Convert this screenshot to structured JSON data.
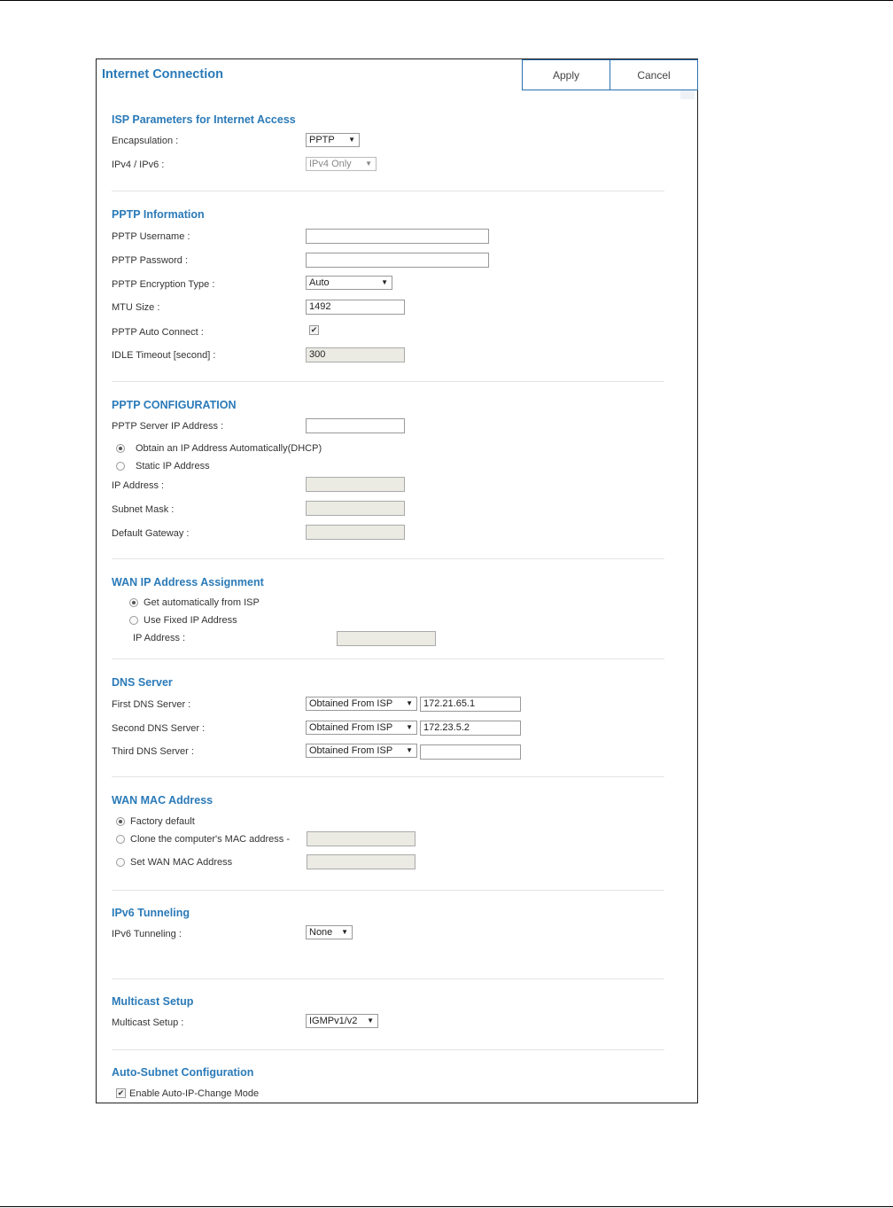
{
  "header": {
    "title": "Internet Connection",
    "apply_label": "Apply",
    "cancel_label": "Cancel"
  },
  "isp": {
    "heading": "ISP Parameters for Internet Access",
    "encapsulation_label": "Encapsulation :",
    "encapsulation_value": "PPTP",
    "ipver_label": "IPv4 / IPv6 :",
    "ipver_value": "IPv4 Only"
  },
  "pptp_info": {
    "heading": "PPTP Information",
    "username_label": "PPTP Username :",
    "username_value": "",
    "password_label": "PPTP Password :",
    "password_value": "",
    "encryption_label": "PPTP Encryption Type :",
    "encryption_value": "Auto",
    "mtu_label": "MTU Size :",
    "mtu_value": "1492",
    "autoconnect_label": "PPTP Auto Connect :",
    "autoconnect_checked": true,
    "idle_label": "IDLE Timeout [second] :",
    "idle_value": "300"
  },
  "pptp_config": {
    "heading": "PPTP CONFIGURATION",
    "server_label": "PPTP Server IP Address :",
    "server_value": "",
    "dhcp_label": "Obtain an IP Address Automatically(DHCP)",
    "static_label": "Static IP Address",
    "ip_label": "IP Address :",
    "mask_label": "Subnet Mask :",
    "gateway_label": "Default Gateway :"
  },
  "wan_ip": {
    "heading": "WAN IP Address Assignment",
    "auto_label": "Get automatically from ISP",
    "fixed_label": "Use Fixed IP Address",
    "ip_label": "IP Address :"
  },
  "dns": {
    "heading": "DNS Server",
    "rows": [
      {
        "label": "First DNS Server :",
        "mode": "Obtained From ISP",
        "value": "172.21.65.1"
      },
      {
        "label": "Second DNS Server :",
        "mode": "Obtained From ISP",
        "value": "172.23.5.2"
      },
      {
        "label": "Third DNS Server :",
        "mode": "Obtained From ISP",
        "value": ""
      }
    ]
  },
  "wan_mac": {
    "heading": "WAN MAC Address",
    "factory_label": "Factory default",
    "clone_label": "Clone the computer's MAC address -",
    "set_label": "Set WAN MAC Address"
  },
  "ipv6": {
    "heading": "IPv6 Tunneling",
    "label": "IPv6 Tunneling :",
    "value": "None"
  },
  "multicast": {
    "heading": "Multicast Setup",
    "label": "Multicast Setup :",
    "value": "IGMPv1/v2"
  },
  "auto_subnet": {
    "heading": "Auto-Subnet Configuration",
    "enable_label": "Enable Auto-IP-Change Mode",
    "enable_checked": true
  },
  "icons": {
    "dropdown": "▼",
    "check": "✔"
  },
  "colors": {
    "accent": "#2a7ab8",
    "button_border": "#2a6fb0"
  }
}
